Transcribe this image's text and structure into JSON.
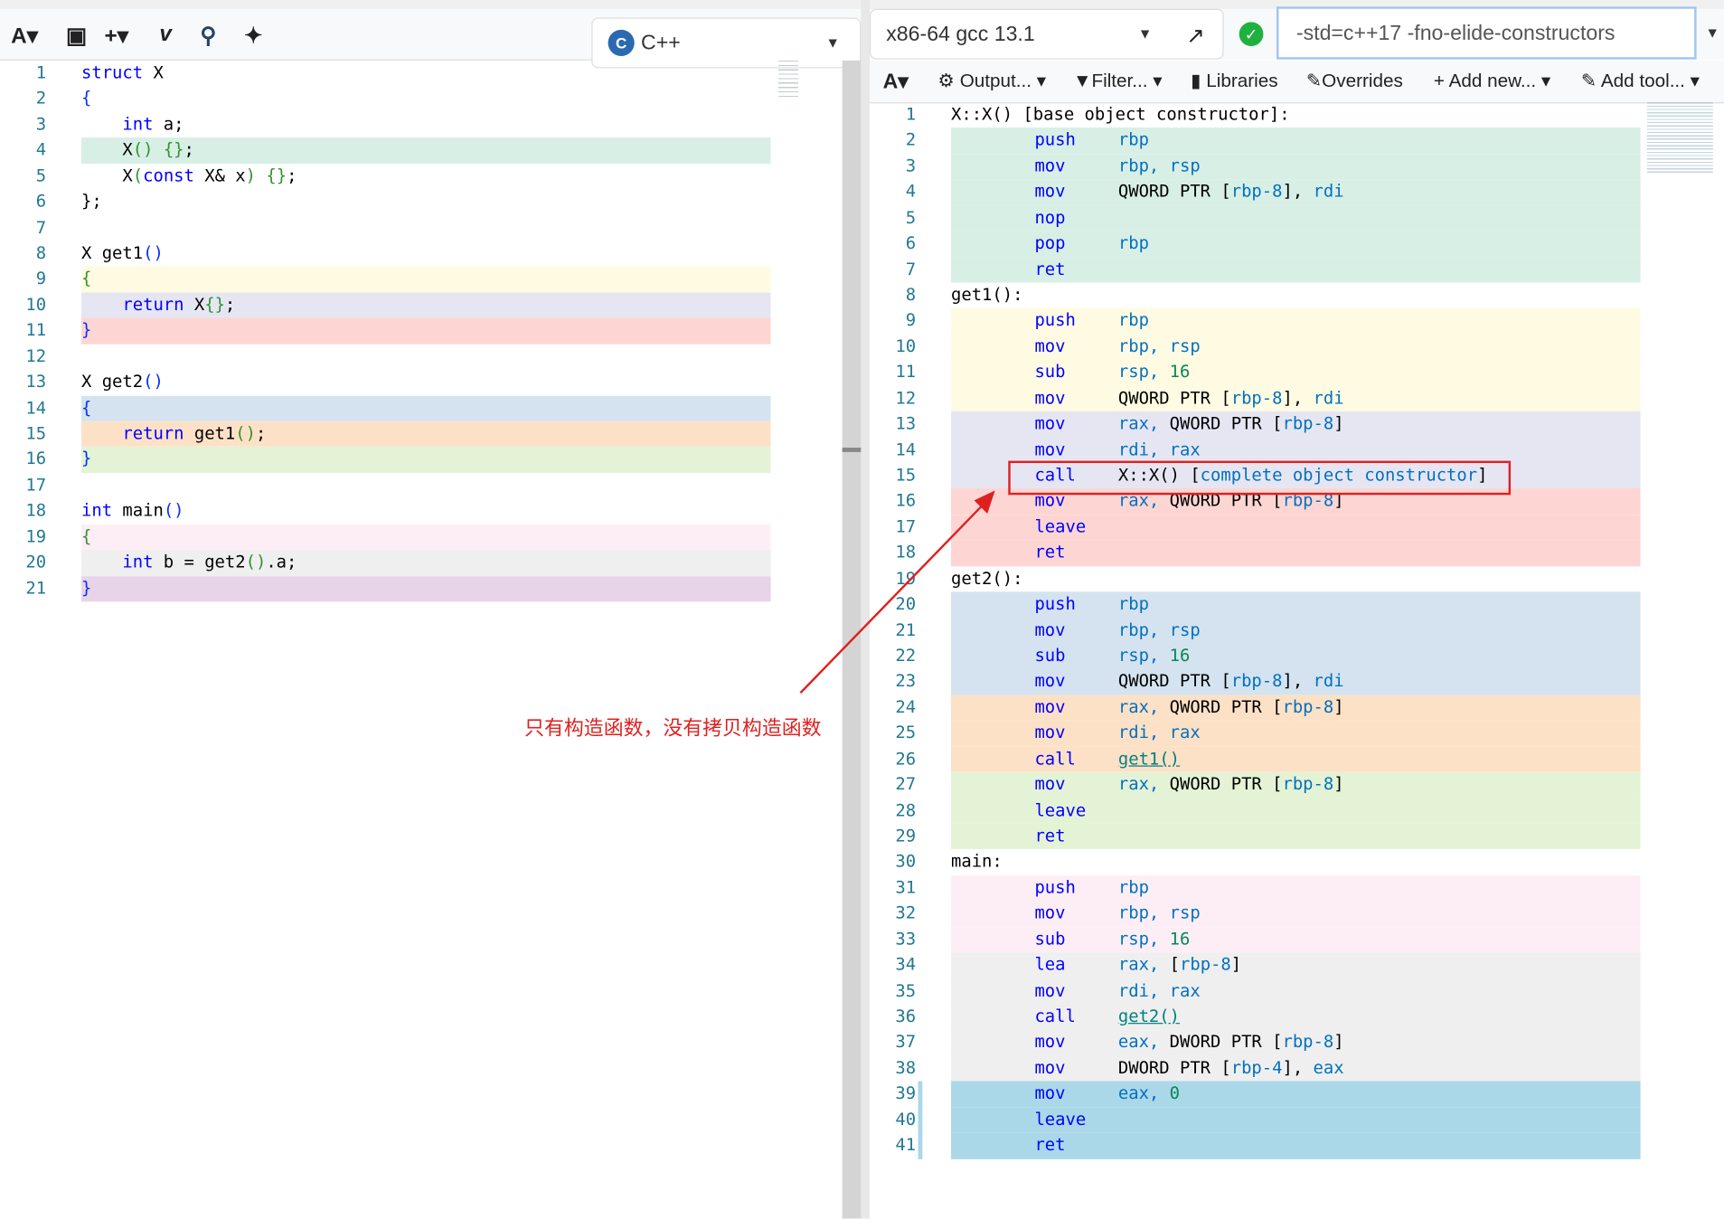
{
  "left_toolbar": {
    "font_icon": "A▾",
    "save_icon": "save-icon",
    "add_label": "+▾",
    "vim_label": "v",
    "language": "C++",
    "language_icon": "cpp-logo"
  },
  "right_toolbar": {
    "compiler": "x86-64 gcc 13.1",
    "status": "ok",
    "options": "-std=c++17 -fno-elide-constructors",
    "buttons": [
      "Output...",
      "Filter...",
      "Libraries",
      "Overrides",
      "Add new...",
      "Add tool..."
    ]
  },
  "colors": {
    "mint": "#d8efe6",
    "yellow": "#fffbe2",
    "lavender": "#e6e6f3",
    "pink": "#fdd6d3",
    "blue": "#d4e3ef",
    "peach": "#fde1c6",
    "green": "#e4f3d5",
    "lightpink": "#fdeef6",
    "gray": "#efefef",
    "purple": "#e8d4e8",
    "lightblue": "#aad8e8",
    "annotation": "#e02020"
  },
  "source": [
    [
      [
        "struct",
        "kw"
      ],
      [
        " X",
        "tx"
      ]
    ],
    [
      [
        "{",
        "pn"
      ]
    ],
    [
      [
        "    ",
        "tx"
      ],
      [
        "int",
        "kw"
      ],
      [
        " a;",
        "tx"
      ]
    ],
    [
      [
        "    X",
        "tx"
      ],
      [
        "()",
        "br"
      ],
      [
        " ",
        "tx"
      ],
      [
        "{}",
        "br"
      ],
      [
        ";",
        "tx"
      ]
    ],
    [
      [
        "    X",
        "tx"
      ],
      [
        "(",
        "br"
      ],
      [
        "const",
        "kw"
      ],
      [
        " X& x",
        "tx"
      ],
      [
        ")",
        "br"
      ],
      [
        " ",
        "tx"
      ],
      [
        "{}",
        "br"
      ],
      [
        ";",
        "tx"
      ]
    ],
    [
      [
        "};",
        "tx"
      ]
    ],
    [],
    [
      [
        "X get1",
        "tx"
      ],
      [
        "()",
        "pn"
      ]
    ],
    [
      [
        "{",
        "br"
      ]
    ],
    [
      [
        "    ",
        "tx"
      ],
      [
        "return",
        "kw"
      ],
      [
        " X",
        "tx"
      ],
      [
        "{}",
        "br"
      ],
      [
        ";",
        "tx"
      ]
    ],
    [
      [
        "}",
        "pn"
      ]
    ],
    [],
    [
      [
        "X get2",
        "tx"
      ],
      [
        "()",
        "pn"
      ]
    ],
    [
      [
        "{",
        "pn"
      ]
    ],
    [
      [
        "    ",
        "tx"
      ],
      [
        "return",
        "kw"
      ],
      [
        " get1",
        "tx"
      ],
      [
        "()",
        "br"
      ],
      [
        ";",
        "tx"
      ]
    ],
    [
      [
        "}",
        "pn"
      ]
    ],
    [],
    [
      [
        "int",
        "kw"
      ],
      [
        " main",
        "tx"
      ],
      [
        "()",
        "pn"
      ]
    ],
    [
      [
        "{",
        "br"
      ]
    ],
    [
      [
        "    ",
        "tx"
      ],
      [
        "int",
        "kw"
      ],
      [
        " b = get2",
        "tx"
      ],
      [
        "()",
        "br"
      ],
      [
        ".a;",
        "tx"
      ]
    ],
    [
      [
        "}",
        "pn"
      ]
    ]
  ],
  "source_bands": [
    null,
    null,
    null,
    "mint",
    null,
    null,
    null,
    null,
    "yellow",
    "lavender",
    "pink",
    null,
    null,
    "blue",
    "peach",
    "green",
    null,
    null,
    "lightpink",
    "gray",
    "purple"
  ],
  "asm": [
    [
      [
        "X::X() [base object constructor]:",
        "lb"
      ]
    ],
    [
      [
        "push",
        "mn"
      ],
      [
        "rbp",
        "rg"
      ]
    ],
    [
      [
        "mov",
        "mn"
      ],
      [
        "rbp, rsp",
        "rg"
      ]
    ],
    [
      [
        "mov",
        "mn"
      ],
      [
        "QWORD PTR [",
        "tx"
      ],
      [
        "rbp-8",
        "rg"
      ],
      [
        "], ",
        "tx"
      ],
      [
        "rdi",
        "rg"
      ]
    ],
    [
      [
        "nop",
        "mn"
      ]
    ],
    [
      [
        "pop",
        "mn"
      ],
      [
        "rbp",
        "rg"
      ]
    ],
    [
      [
        "ret",
        "mn"
      ]
    ],
    [
      [
        "get1():",
        "lb"
      ]
    ],
    [
      [
        "push",
        "mn"
      ],
      [
        "rbp",
        "rg"
      ]
    ],
    [
      [
        "mov",
        "mn"
      ],
      [
        "rbp, rsp",
        "rg"
      ]
    ],
    [
      [
        "sub",
        "mn"
      ],
      [
        "rsp, ",
        "rg"
      ],
      [
        "16",
        "nm"
      ]
    ],
    [
      [
        "mov",
        "mn"
      ],
      [
        "QWORD PTR [",
        "tx"
      ],
      [
        "rbp-8",
        "rg"
      ],
      [
        "], ",
        "tx"
      ],
      [
        "rdi",
        "rg"
      ]
    ],
    [
      [
        "mov",
        "mn"
      ],
      [
        "rax, ",
        "rg"
      ],
      [
        "QWORD PTR [",
        "tx"
      ],
      [
        "rbp-8",
        "rg"
      ],
      [
        "]",
        "tx"
      ]
    ],
    [
      [
        "mov",
        "mn"
      ],
      [
        "rdi, rax",
        "rg"
      ]
    ],
    [
      [
        "call",
        "mn"
      ],
      [
        "X::X() [",
        "tx"
      ],
      [
        "complete object constructor",
        "rg"
      ],
      [
        "]",
        "tx"
      ]
    ],
    [
      [
        "mov",
        "mn"
      ],
      [
        "rax, ",
        "rg"
      ],
      [
        "QWORD PTR [",
        "tx"
      ],
      [
        "rbp-8",
        "rg"
      ],
      [
        "]",
        "tx"
      ]
    ],
    [
      [
        "leave",
        "mn"
      ]
    ],
    [
      [
        "ret",
        "mn"
      ]
    ],
    [
      [
        "get2():",
        "lb"
      ]
    ],
    [
      [
        "push",
        "mn"
      ],
      [
        "rbp",
        "rg"
      ]
    ],
    [
      [
        "mov",
        "mn"
      ],
      [
        "rbp, rsp",
        "rg"
      ]
    ],
    [
      [
        "sub",
        "mn"
      ],
      [
        "rsp, ",
        "rg"
      ],
      [
        "16",
        "nm"
      ]
    ],
    [
      [
        "mov",
        "mn"
      ],
      [
        "QWORD PTR [",
        "tx"
      ],
      [
        "rbp-8",
        "rg"
      ],
      [
        "], ",
        "tx"
      ],
      [
        "rdi",
        "rg"
      ]
    ],
    [
      [
        "mov",
        "mn"
      ],
      [
        "rax, ",
        "rg"
      ],
      [
        "QWORD PTR [",
        "tx"
      ],
      [
        "rbp-8",
        "rg"
      ],
      [
        "]",
        "tx"
      ]
    ],
    [
      [
        "mov",
        "mn"
      ],
      [
        "rdi, rax",
        "rg"
      ]
    ],
    [
      [
        "call",
        "mn"
      ],
      [
        "get1()",
        "lk"
      ]
    ],
    [
      [
        "mov",
        "mn"
      ],
      [
        "rax, ",
        "rg"
      ],
      [
        "QWORD PTR [",
        "tx"
      ],
      [
        "rbp-8",
        "rg"
      ],
      [
        "]",
        "tx"
      ]
    ],
    [
      [
        "leave",
        "mn"
      ]
    ],
    [
      [
        "ret",
        "mn"
      ]
    ],
    [
      [
        "main:",
        "lb"
      ]
    ],
    [
      [
        "push",
        "mn"
      ],
      [
        "rbp",
        "rg"
      ]
    ],
    [
      [
        "mov",
        "mn"
      ],
      [
        "rbp, rsp",
        "rg"
      ]
    ],
    [
      [
        "sub",
        "mn"
      ],
      [
        "rsp, ",
        "rg"
      ],
      [
        "16",
        "nm"
      ]
    ],
    [
      [
        "lea",
        "mn"
      ],
      [
        "rax, ",
        "rg"
      ],
      [
        "[",
        "tx"
      ],
      [
        "rbp-8",
        "rg"
      ],
      [
        "]",
        "tx"
      ]
    ],
    [
      [
        "mov",
        "mn"
      ],
      [
        "rdi, rax",
        "rg"
      ]
    ],
    [
      [
        "call",
        "mn"
      ],
      [
        "get2()",
        "lk"
      ]
    ],
    [
      [
        "mov",
        "mn"
      ],
      [
        "eax, ",
        "rg"
      ],
      [
        "DWORD PTR [",
        "tx"
      ],
      [
        "rbp-8",
        "rg"
      ],
      [
        "]",
        "tx"
      ]
    ],
    [
      [
        "mov",
        "mn"
      ],
      [
        "DWORD PTR [",
        "tx"
      ],
      [
        "rbp-4",
        "rg"
      ],
      [
        "], ",
        "tx"
      ],
      [
        "eax",
        "rg"
      ]
    ],
    [
      [
        "mov",
        "mn"
      ],
      [
        "eax, ",
        "rg"
      ],
      [
        "0",
        "nm"
      ]
    ],
    [
      [
        "leave",
        "mn"
      ]
    ],
    [
      [
        "ret",
        "mn"
      ]
    ]
  ],
  "asm_bands": [
    null,
    "mint",
    "mint",
    "mint",
    "mint",
    "mint",
    "mint",
    null,
    "yellow",
    "yellow",
    "yellow",
    "yellow",
    "lavender",
    "lavender",
    "lavender",
    "pink",
    "pink",
    "pink",
    null,
    "blue",
    "blue",
    "blue",
    "blue",
    "peach",
    "peach",
    "peach",
    "green",
    "green",
    "green",
    null,
    "lightpink",
    "lightpink",
    "lightpink",
    "gray",
    "gray",
    "gray",
    "gray",
    "gray",
    "lightblue",
    "lightblue",
    "lightblue"
  ],
  "annotation": {
    "text": "只有构造函数，没有拷贝构造函数"
  }
}
